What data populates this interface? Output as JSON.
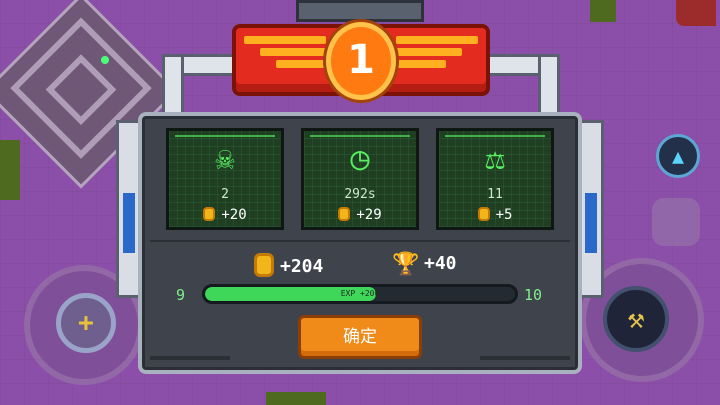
{
  "banner": {
    "rank": "1"
  },
  "stats": [
    {
      "icon": "skull-icon",
      "glyph": "☠",
      "value": "2",
      "reward": "+20"
    },
    {
      "icon": "clock-icon",
      "glyph": "◷",
      "value": "292s",
      "reward": "+29"
    },
    {
      "icon": "weight-icon",
      "glyph": "⚖",
      "value": "11",
      "reward": "+5"
    }
  ],
  "totals": {
    "coins": "+204",
    "trophies": "+40"
  },
  "level": {
    "current": "9",
    "next": "10",
    "exp_label": "EXP +200",
    "exp_fraction": 0.55
  },
  "confirm_label": "确定",
  "colors": {
    "accent": "#f08a18",
    "panel": "#3e434c",
    "stat_green": "#59ef63",
    "banner_red": "#e32c1f"
  }
}
